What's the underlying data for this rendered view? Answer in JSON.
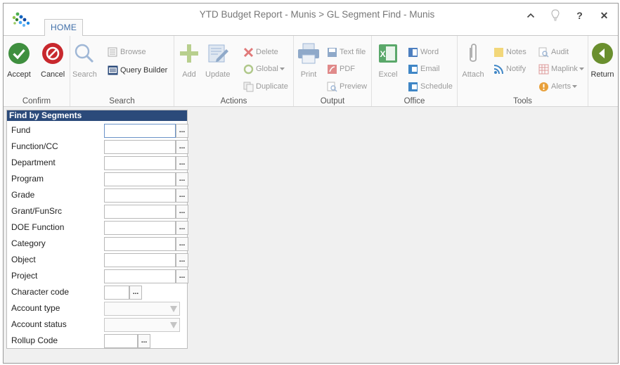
{
  "window": {
    "title": "YTD Budget Report - Munis > GL Segment Find - Munis",
    "tab_home": "HOME",
    "controls": {
      "help": "?",
      "close": "✕"
    }
  },
  "ribbon": {
    "confirm": {
      "label": "Confirm",
      "accept": "Accept",
      "cancel": "Cancel"
    },
    "search": {
      "label": "Search",
      "search": "Search",
      "browse": "Browse",
      "query_builder": "Query Builder"
    },
    "actions": {
      "label": "Actions",
      "add": "Add",
      "update": "Update",
      "delete": "Delete",
      "global": "Global",
      "duplicate": "Duplicate"
    },
    "output": {
      "label": "Output",
      "print": "Print",
      "text_file": "Text file",
      "pdf": "PDF",
      "preview": "Preview"
    },
    "office": {
      "label": "Office",
      "excel": "Excel",
      "word": "Word",
      "email": "Email",
      "schedule": "Schedule"
    },
    "tools": {
      "label": "Tools",
      "attach": "Attach",
      "notes": "Notes",
      "notify": "Notify",
      "audit": "Audit",
      "maplink": "Maplink",
      "alerts": "Alerts"
    },
    "return": "Return"
  },
  "panel": {
    "title": "Find by Segments",
    "lookup_glyph": "...",
    "fields": [
      {
        "label": "Fund",
        "value": ""
      },
      {
        "label": "Function/CC",
        "value": ""
      },
      {
        "label": "Department",
        "value": ""
      },
      {
        "label": "Program",
        "value": ""
      },
      {
        "label": "Grade",
        "value": ""
      },
      {
        "label": "Grant/FunSrc",
        "value": ""
      },
      {
        "label": "DOE Function",
        "value": ""
      },
      {
        "label": "Category",
        "value": ""
      },
      {
        "label": "Object",
        "value": ""
      },
      {
        "label": "Project",
        "value": ""
      },
      {
        "label": "Character code",
        "value": ""
      },
      {
        "label": "Account type",
        "value": ""
      },
      {
        "label": "Account status",
        "value": ""
      },
      {
        "label": "Rollup Code",
        "value": ""
      }
    ]
  },
  "colors": {
    "accent_blue": "#3f6ea8",
    "panel_header": "#2b4a7a",
    "accept_green": "#3f8f3f",
    "cancel_red": "#c8282d"
  }
}
